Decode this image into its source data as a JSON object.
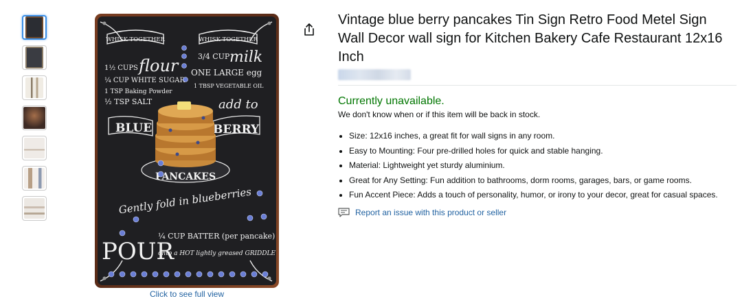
{
  "gallery": {
    "thumbnails": [
      {
        "name": "thumb-1",
        "color": "#2b2d33"
      },
      {
        "name": "thumb-2",
        "color": "#3a3c42"
      },
      {
        "name": "thumb-3",
        "color": "#d9cfbf"
      },
      {
        "name": "thumb-4",
        "color": "#4a3b36"
      },
      {
        "name": "thumb-5",
        "color": "#e7e2de"
      },
      {
        "name": "thumb-6",
        "color": "#e9e4df"
      },
      {
        "name": "thumb-7",
        "color": "#e6e2dc"
      }
    ],
    "sign": {
      "whisk_left": "WHISK TOGETHER",
      "whisk_right": "WHISK TOGETHER",
      "flour_amt": "1½ CUPS",
      "flour": "flour",
      "milk_amt": "3/4 CUP",
      "milk": "milk",
      "sugar": "¼ CUP WHITE SUGAR",
      "egg": "ONE LARGE egg",
      "baking": "1 TSP Baking Powder",
      "oil": "1 TBSP VEGETABLE OIL",
      "salt": "½ TSP SALT",
      "add_to": "add to",
      "blue": "BLUE",
      "berry": "BERRY",
      "pancakes": "PANCAKES",
      "gently": "Gently fold in blueberries",
      "pour": "POUR",
      "batter": "¼ CUP BATTER (per pancake)",
      "onto_hot": "onto a HOT lightly greased GRIDDLE"
    },
    "full_view_label": "Click to see full view"
  },
  "product": {
    "title": "Vintage blue berry pancakes Tin Sign Retro Food Metel Sign Wall Decor wall sign for Kitchen Bakery Cafe Restaurant 12x16 Inch",
    "availability": "Currently unavailable.",
    "stock_note": "We don't know when or if this item will be back in stock.",
    "bullets": [
      "Size: 12x16 inches, a great fit for wall signs in any room.",
      "Easy to Mounting: Four pre-drilled holes for quick and stable hanging.",
      "Material: Lightweight yet sturdy aluminium.",
      "Great for Any Setting: Fun addition to bathrooms, dorm rooms, garages, bars, or game rooms.",
      "Fun Accent Piece: Adds a touch of personality, humor, or irony to your decor, great for casual spaces."
    ],
    "report_link": "Report an issue with this product or seller"
  },
  "icons": {
    "share": "share-icon",
    "report": "report-message-icon"
  },
  "colors": {
    "availability": "#007600",
    "link": "#2162a1",
    "thumb_active_border": "#3a8ee6"
  }
}
